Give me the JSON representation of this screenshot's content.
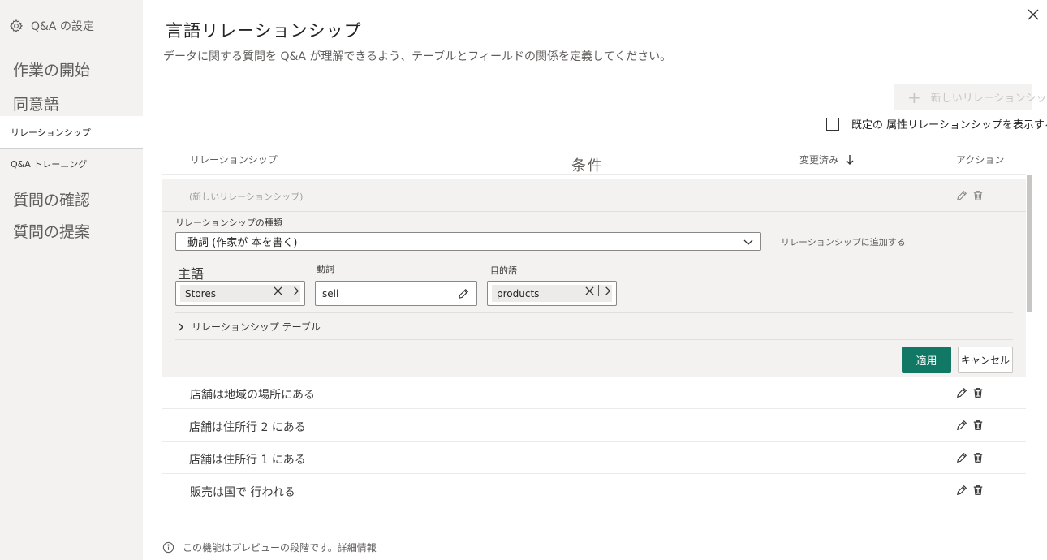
{
  "sidebar": {
    "header": "Q&A の設定",
    "items": [
      {
        "label": "作業の開始"
      },
      {
        "label": "同意語"
      },
      {
        "label": "リレーションシップ"
      },
      {
        "label": "Q&A トレーニング"
      },
      {
        "label": "質問の確認"
      },
      {
        "label": "質問の提案"
      }
    ]
  },
  "main": {
    "title": "言語リレーションシップ",
    "subtitle": "データに関する質問を Q&A が理解できるよう、テーブルとフィールドの関係を定義してください。",
    "new_relationship_label": "新しいリレーションシップ",
    "show_default_label": "既定の 属性リレーションシップを表示する",
    "columns": {
      "relationship": "リレーションシップ",
      "condition": "条件",
      "modified": "変更済み",
      "actions": "アクション"
    }
  },
  "editor": {
    "new_row_label": "(新しいリレーションシップ)",
    "type_label": "リレーションシップの種類",
    "type_value": "動詞 (作家が 本を書く)",
    "add_to_relationship": "リレーションシップに追加する",
    "subject_label": "主語",
    "subject_value": "Stores",
    "verb_label": "動詞",
    "verb_value": "sell",
    "object_label": "目的語",
    "object_value": "products",
    "tables_label": "リレーションシップ テーブル",
    "apply_label": "適用",
    "cancel_label": "キャンセル"
  },
  "rows": [
    {
      "text": "店舗は地域の場所にある"
    },
    {
      "text": "店舗は住所行 2 にある"
    },
    {
      "text": "店舗は住所行 1 にある"
    },
    {
      "text": "販売は国で 行われる"
    }
  ],
  "footer": {
    "text": "この機能はプレビューの段階です。詳細情報"
  },
  "colors": {
    "accent": "#117865",
    "sidebar_bg": "#f3f2f1"
  }
}
